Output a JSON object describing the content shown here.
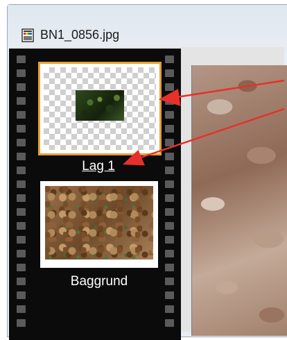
{
  "window": {
    "title": "BN1_0856.jpg",
    "icon": "image-file-icon"
  },
  "layers": [
    {
      "label": "Lag 1",
      "selected": true
    },
    {
      "label": "Baggrund",
      "selected": false
    }
  ],
  "colors": {
    "selection_border": "#e8a036",
    "filmstrip": "#0b0b0b",
    "annotation_arrow": "#e8302a"
  }
}
